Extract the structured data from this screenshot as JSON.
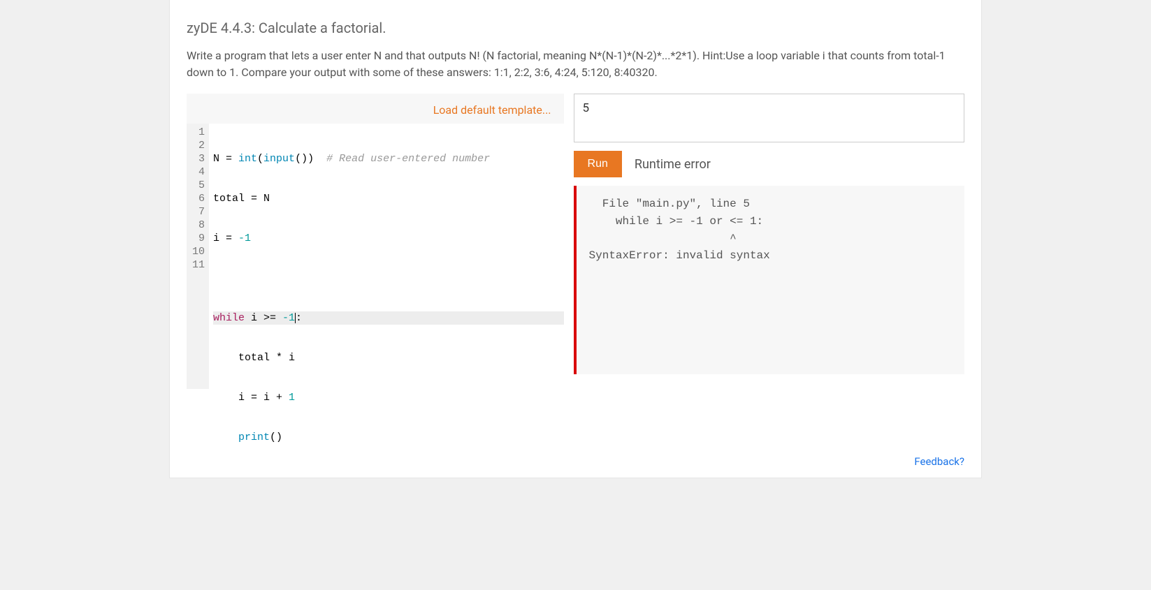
{
  "title": "zyDE 4.4.3: Calculate a factorial.",
  "instructions": "Write a program that lets a user enter N and that outputs N! (N factorial, meaning N*(N-1)*(N-2)*...*2*1). Hint:Use a loop variable i that counts from total-1 down to 1. Compare your output with some of these answers: 1:1, 2:2, 3:6, 4:24, 5:120, 8:40320.",
  "load_template_label": "Load default template...",
  "code": {
    "line_numbers": [
      "1",
      "2",
      "3",
      "4",
      "5",
      "6",
      "7",
      "8",
      "9",
      "10",
      "11"
    ],
    "l1_a": "N = ",
    "l1_b": "int",
    "l1_c": "(",
    "l1_d": "input",
    "l1_e": "())  ",
    "l1_f": "# Read user-entered number",
    "l2": "total = N",
    "l3_a": "i = ",
    "l3_b": "-1",
    "l5_a": "while",
    "l5_b": " i >= ",
    "l5_c": "-1",
    "l5_d": ":",
    "l6": "    total * i",
    "l7_a": "    i = i + ",
    "l7_b": "1",
    "l8_a": "    ",
    "l8_b": "print",
    "l8_c": "()"
  },
  "input_value": "5",
  "run_label": "Run",
  "status_label": "Runtime error",
  "output_text": "  File \"main.py\", line 5\n    while i >= -1 or <= 1:\n                     ^\nSyntaxError: invalid syntax",
  "feedback_label": "Feedback?"
}
